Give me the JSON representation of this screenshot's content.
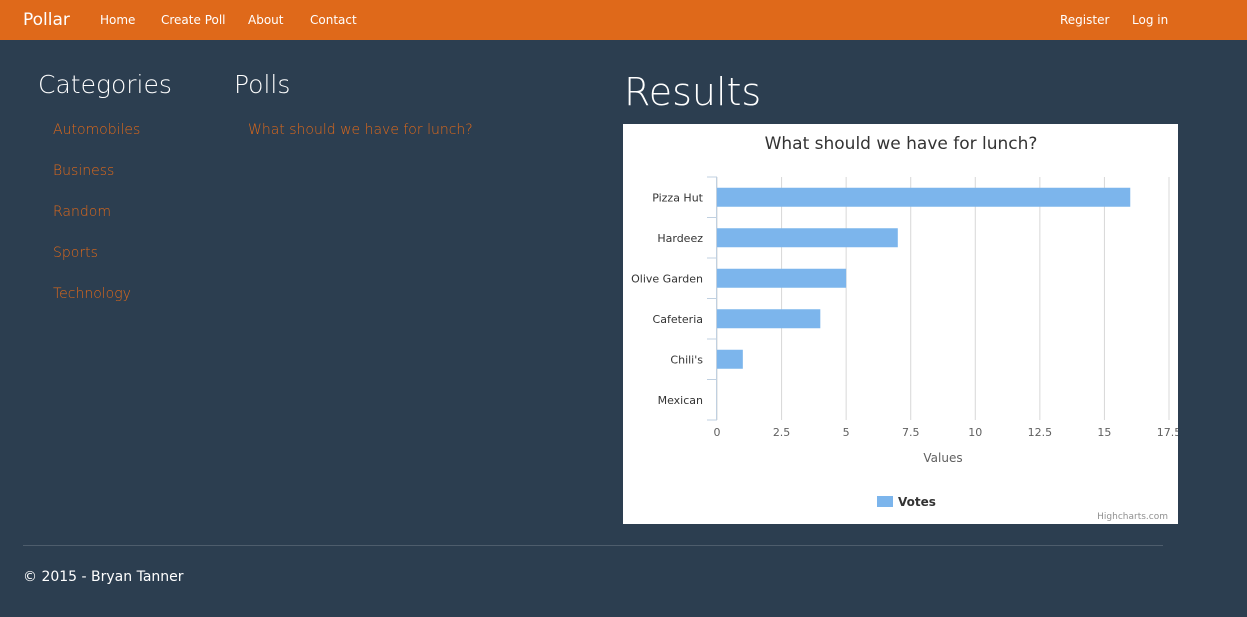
{
  "navbar": {
    "brand": "Pollar",
    "links": [
      "Home",
      "Create Poll",
      "About",
      "Contact"
    ],
    "right_links": [
      "Register",
      "Log in"
    ],
    "color": "#df691a"
  },
  "categories": {
    "title": "Categories",
    "items": [
      "Automobiles",
      "Business",
      "Random",
      "Sports",
      "Technology"
    ]
  },
  "polls": {
    "title": "Polls",
    "items": [
      "What should we have for lunch?"
    ]
  },
  "results": {
    "title": "Results"
  },
  "chart_data": {
    "type": "bar",
    "orientation": "horizontal",
    "title": "What should we have for lunch?",
    "categories": [
      "Pizza Hut",
      "Hardeez",
      "Olive Garden",
      "Cafeteria",
      "Chili's",
      "Mexican"
    ],
    "series": [
      {
        "name": "Votes",
        "values": [
          16,
          7,
          5,
          4,
          1,
          0
        ],
        "color": "#7cb5ec"
      }
    ],
    "xlabel": "",
    "ylabel": "Values",
    "ylim": [
      0,
      17.5
    ],
    "ticks": [
      "0",
      "2.5",
      "5",
      "7.5",
      "10",
      "12.5",
      "15",
      "17.5"
    ],
    "grid": true,
    "legend": "bottom-center",
    "credits": "Highcharts.com"
  },
  "footer": {
    "text": "© 2015 - Bryan Tanner"
  },
  "colors": {
    "background": "#2c3e50",
    "accent": "#df691a"
  }
}
